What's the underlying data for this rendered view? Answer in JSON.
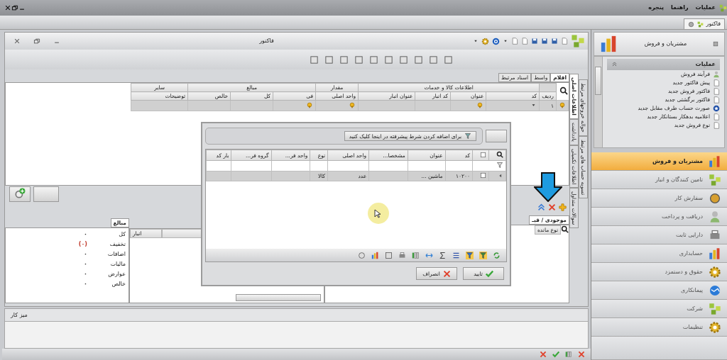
{
  "menu_bar": {
    "items": [
      "عملیات",
      "راهنما",
      "پنجره"
    ]
  },
  "document_tabs": [
    {
      "label": "فاکتور",
      "selected": true
    }
  ],
  "form": {
    "title": "فاکتور",
    "tabs": [
      {
        "label": "اقلام",
        "selected": true
      },
      {
        "label": "واسط",
        "selected": false
      },
      {
        "label": "اسناد مرتبط",
        "selected": false
      }
    ],
    "side_tabs_inner": [
      {
        "label": "اطلاعات اصلی",
        "selected": true
      },
      {
        "label": "یادداشت",
        "selected": false
      },
      {
        "label": "اطلاعات تکمیلی",
        "selected": false
      },
      {
        "label": "سوالات متداول",
        "selected": false
      }
    ],
    "side_tabs_outer": [
      {
        "label": "حواله خروجهای مرتبط",
        "selected": false
      },
      {
        "label": "تسویه حساب های مرتبط",
        "selected": false
      }
    ],
    "items_grid": {
      "row_header": "ردیف",
      "groups": [
        {
          "label": "اطلاعات کالا و خدمات",
          "columns": [
            "کد",
            "عنوان",
            "کد انبار",
            "عنوان انبار"
          ]
        },
        {
          "label": "مقدار",
          "columns": [
            "واحد اصلی"
          ]
        },
        {
          "label": "مبالغ",
          "columns": [
            "فی",
            "کل",
            "خالص"
          ]
        },
        {
          "label": "سایر",
          "columns": [
            "توضیحات"
          ]
        }
      ],
      "rows": [
        {
          "number": "۱",
          "selected": true
        }
      ]
    },
    "stock_tab": {
      "label": "موجودی / قیـ",
      "selected": true
    },
    "stock_grid": {
      "columns": [
        "نوع مانده"
      ]
    },
    "amounts_panel": {
      "tab": "مبالغ",
      "rows": [
        {
          "label": "کل",
          "value": "۰"
        },
        {
          "label": "تخفیف",
          "value": "(۰)",
          "color": "#c0392b"
        },
        {
          "label": "اضافات",
          "value": "۰"
        },
        {
          "label": "مالیات",
          "value": "۰"
        },
        {
          "label": "عوارض",
          "value": "۰"
        },
        {
          "label": "خالص",
          "value": "۰"
        }
      ]
    },
    "warehouse_grid": {
      "columns": [
        "انبار"
      ]
    }
  },
  "dialog": {
    "filter_hint": "برای اضافه کردن شرط پیشرفته در اینجا کلیک کنید",
    "select_all_checked": false,
    "columns": [
      "کد",
      "عنوان",
      "مشخصا...",
      "واحد اصلی",
      "نوع",
      "واحد فر...",
      "گروه فر...",
      "بار کد"
    ],
    "rows": [
      {
        "cells": [
          "۱۰۲۰۰",
          "ماشین ...",
          null,
          "عدد",
          "کالا",
          null,
          null,
          null
        ],
        "selected": true,
        "checked": false
      }
    ],
    "buttons": [
      {
        "label": "تایید",
        "kind": "ok"
      },
      {
        "label": "انصراف",
        "kind": "cancel"
      }
    ]
  },
  "workspace": {
    "title": "میز کار"
  },
  "sidebar": {
    "title": "مشتریان و فروش",
    "operations": {
      "title": "عملیات",
      "expanded": true,
      "items": [
        "فرآیند فروش",
        "پیش فاکتور جدید",
        "فاکتور فروش جدید",
        "فاکتور برگشتی جدید",
        "صورت حساب طرف مقابل جدید",
        "اعلامیه بدهکار بستانکار جدید",
        "نوع فروش جدید"
      ]
    },
    "modules": [
      {
        "label": "مشتریان و فروش",
        "selected": true
      },
      {
        "label": "تامین کنندگان و انبار",
        "selected": false
      },
      {
        "label": "سفارش کار",
        "selected": false
      },
      {
        "label": "دریافت و پرداخت",
        "selected": false
      },
      {
        "label": "دارایی ثابت",
        "selected": false
      },
      {
        "label": "حسابداری",
        "selected": false
      },
      {
        "label": "حقوق و دستمزد",
        "selected": false
      },
      {
        "label": "پیمانکاری",
        "selected": false
      },
      {
        "label": "شرکت",
        "selected": false
      },
      {
        "label": "تنظیمات",
        "selected": false
      }
    ]
  }
}
